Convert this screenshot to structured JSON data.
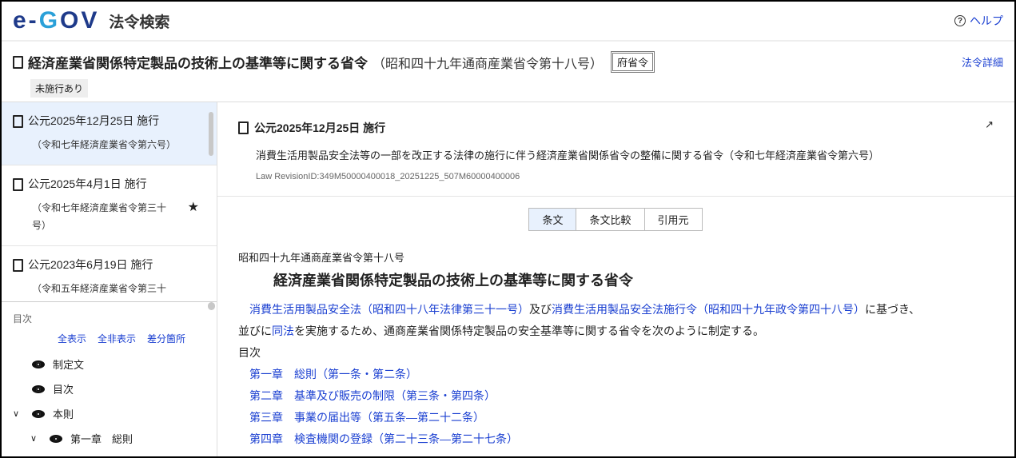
{
  "header": {
    "logo": "e-GOV",
    "site": "法令検索",
    "help": "ヘルプ"
  },
  "law": {
    "title": "経済産業省関係特定製品の技術上の基準等に関する省令",
    "number": "（昭和四十九年通商産業省令第十八号）",
    "type_badge": "府省令",
    "status_tag": "未施行あり",
    "detail_link": "法令詳細"
  },
  "revisions": [
    {
      "date": "公元2025年12月25日 施行",
      "note": "（令和七年経済産業省令第六号）"
    },
    {
      "date": "公元2025年4月1日 施行",
      "note": "（令和七年経済産業省令第三十号）"
    },
    {
      "date": "公元2023年6月19日 施行",
      "note": "（令和五年経済産業省令第三十"
    }
  ],
  "toc": {
    "heading": "目次",
    "show_all": "全表示",
    "hide_all": "全非表示",
    "diff": "差分箇所",
    "items": [
      {
        "label": "制定文"
      },
      {
        "label": "目次"
      },
      {
        "label": "本則"
      },
      {
        "label": "第一章　総則"
      }
    ]
  },
  "revision_detail": {
    "date": "公元2025年12月25日 施行",
    "desc": "消費生活用製品安全法等の一部を改正する法律の施行に伴う経済産業省関係省令の整備に関する省令（令和七年経済産業省令第六号）",
    "id": "Law RevisionID:349M50000400018_20251225_507M60000400006"
  },
  "tabs": [
    "条文",
    "条文比較",
    "引用元"
  ],
  "content": {
    "law_number": "昭和四十九年通商産業省令第十八号",
    "title": "経済産業省関係特定製品の技術上の基準等に関する省令",
    "p1_link1": "消費生活用製品安全法（昭和四十八年法律第三十一号）",
    "p1_mid": "及び",
    "p1_link2": "消費生活用製品安全法施行令（昭和四十九年政令第四十八号）",
    "p1_end": "に基づき、",
    "p2_start": "並びに",
    "p2_link": "同法",
    "p2_end": "を実施するため、通商産業省関係特定製品の安全基準等に関する省令を次のように制定する。",
    "toc_label": "目次",
    "chapters": [
      "第一章　総則（第一条・第二条）",
      "第二章　基準及び販売の制限（第三条・第四条）",
      "第三章　事業の届出等（第五条―第二十二条）",
      "第四章　検査機関の登録（第二十三条―第二十七条）"
    ]
  }
}
